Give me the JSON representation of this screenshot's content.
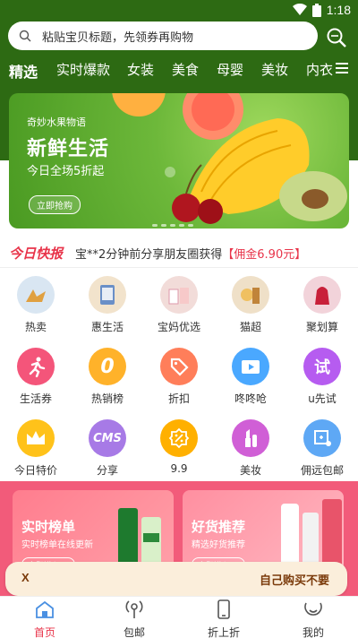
{
  "status_bar": {
    "time": "1:18"
  },
  "search": {
    "placeholder": "粘贴宝贝标题，先领券再购物"
  },
  "nav": {
    "tabs": [
      "精选",
      "实时爆款",
      "女装",
      "美食",
      "母婴",
      "美妆",
      "内衣"
    ],
    "active": "精选"
  },
  "banner": {
    "small": "奇妙水果物语",
    "title": "新鲜生活",
    "subtitle": "今日全场5折起",
    "button": "立即抢购"
  },
  "news": {
    "logo": "今日快报",
    "text": "宝**2分钟前分享朋友圈获得",
    "commission": "【佣金6.90元】"
  },
  "grid": [
    {
      "label": "热卖",
      "icon": "hot-sale-icon",
      "color": "#d9e6f2"
    },
    {
      "label": "惠生活",
      "icon": "life-icon",
      "color": "#f2e3cc"
    },
    {
      "label": "宝妈优选",
      "icon": "mom-select-icon",
      "color": "#f2dcd9"
    },
    {
      "label": "猫超",
      "icon": "tmall-market-icon",
      "color": "#efe0c8"
    },
    {
      "label": "聚划算",
      "icon": "juhuasuan-icon",
      "color": "#f2d3da"
    },
    {
      "label": "生活券",
      "icon": "runner-icon",
      "color": "#f4557a"
    },
    {
      "label": "热销榜",
      "icon": "zero-icon",
      "color": "#ffb22a"
    },
    {
      "label": "折扣",
      "icon": "discount-tag-icon",
      "color": "#ff7e5a"
    },
    {
      "label": "咚咚呛",
      "icon": "video-icon",
      "color": "#4aa8ff"
    },
    {
      "label": "u先试",
      "icon": "try-icon",
      "color": "#b65cf0"
    },
    {
      "label": "今日特价",
      "icon": "crown-icon",
      "color": "#ffc21a"
    },
    {
      "label": "分享",
      "icon": "cms-icon",
      "color": "#a77ae6"
    },
    {
      "label": "9.9",
      "icon": "percent-icon",
      "color": "#ffb000"
    },
    {
      "label": "美妆",
      "icon": "lipstick-icon",
      "color": "#d05fd6"
    },
    {
      "label": "佣远包邮",
      "icon": "cart-icon",
      "color": "#5ea8f5"
    }
  ],
  "grid_text": {
    "try": "试",
    "zero": "0",
    "cms": "CMS"
  },
  "promo": [
    {
      "title": "实时榜单",
      "subtitle": "实时榜单在线更新",
      "button": "立即进入 >"
    },
    {
      "title": "好货推荐",
      "subtitle": "精选好货推荐",
      "button": "立即进入 >"
    }
  ],
  "toast": {
    "close": "X",
    "text": "自己购买不要"
  },
  "tabbar": [
    {
      "label": "首页",
      "icon": "home-icon",
      "active": true
    },
    {
      "label": "包邮",
      "icon": "shipping-icon",
      "active": false
    },
    {
      "label": "折上折",
      "icon": "phone-icon",
      "active": false
    },
    {
      "label": "我的",
      "icon": "profile-icon",
      "active": false
    }
  ],
  "colors": {
    "brand_green": "#2d6a13",
    "accent_red": "#e8344a"
  }
}
